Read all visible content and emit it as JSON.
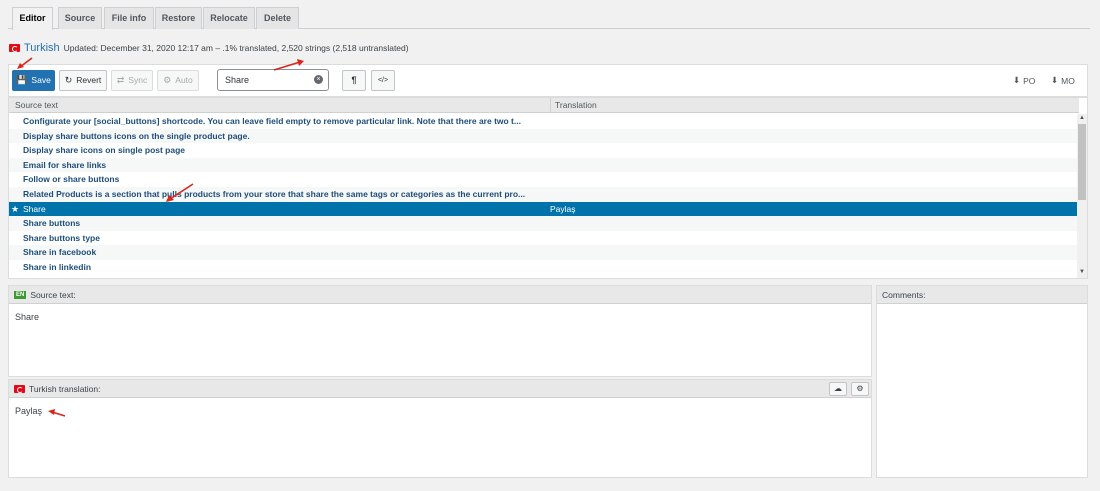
{
  "tabs": [
    {
      "label": "Editor",
      "active": true
    },
    {
      "label": "Source"
    },
    {
      "label": "File info"
    },
    {
      "label": "Restore"
    },
    {
      "label": "Relocate"
    },
    {
      "label": "Delete"
    }
  ],
  "header": {
    "language": "Turkish",
    "meta": "Updated: December 31, 2020 12:17 am – .1% translated, 2,520 strings (2,518 untranslated)"
  },
  "toolbar": {
    "save": "Save",
    "revert": "Revert",
    "sync": "Sync",
    "auto": "Auto",
    "search_value": "Share",
    "po": "PO",
    "mo": "MO"
  },
  "grid": {
    "col_source": "Source text",
    "col_translation": "Translation",
    "rows": [
      {
        "source": "Configurate your [social_buttons] shortcode. You can leave field empty to remove particular link. Note that there are two t...",
        "translation": ""
      },
      {
        "source": "Display share buttons icons on the single product page.",
        "translation": ""
      },
      {
        "source": "Display share icons on single post page",
        "translation": ""
      },
      {
        "source": "Email for share links",
        "translation": ""
      },
      {
        "source": "Follow or share buttons",
        "translation": ""
      },
      {
        "source": "Related Products is a section that pulls products from your store that share the same tags or categories as the current pro...",
        "translation": ""
      },
      {
        "source": "Share",
        "translation": "Paylaş",
        "selected": true
      },
      {
        "source": "Share buttons",
        "translation": ""
      },
      {
        "source": "Share buttons type",
        "translation": ""
      },
      {
        "source": "Share in facebook",
        "translation": ""
      },
      {
        "source": "Share in linkedin",
        "translation": ""
      }
    ]
  },
  "source_pane": {
    "badge": "EN",
    "title": "Source text:",
    "text": "Share"
  },
  "translation_pane": {
    "title": "Turkish translation:",
    "text": "Paylaş"
  },
  "comments_pane": {
    "title": "Comments:"
  },
  "colors": {
    "primary": "#2271b1",
    "selected_row": "#0073aa",
    "annotation_arrow": "#d9261c"
  }
}
